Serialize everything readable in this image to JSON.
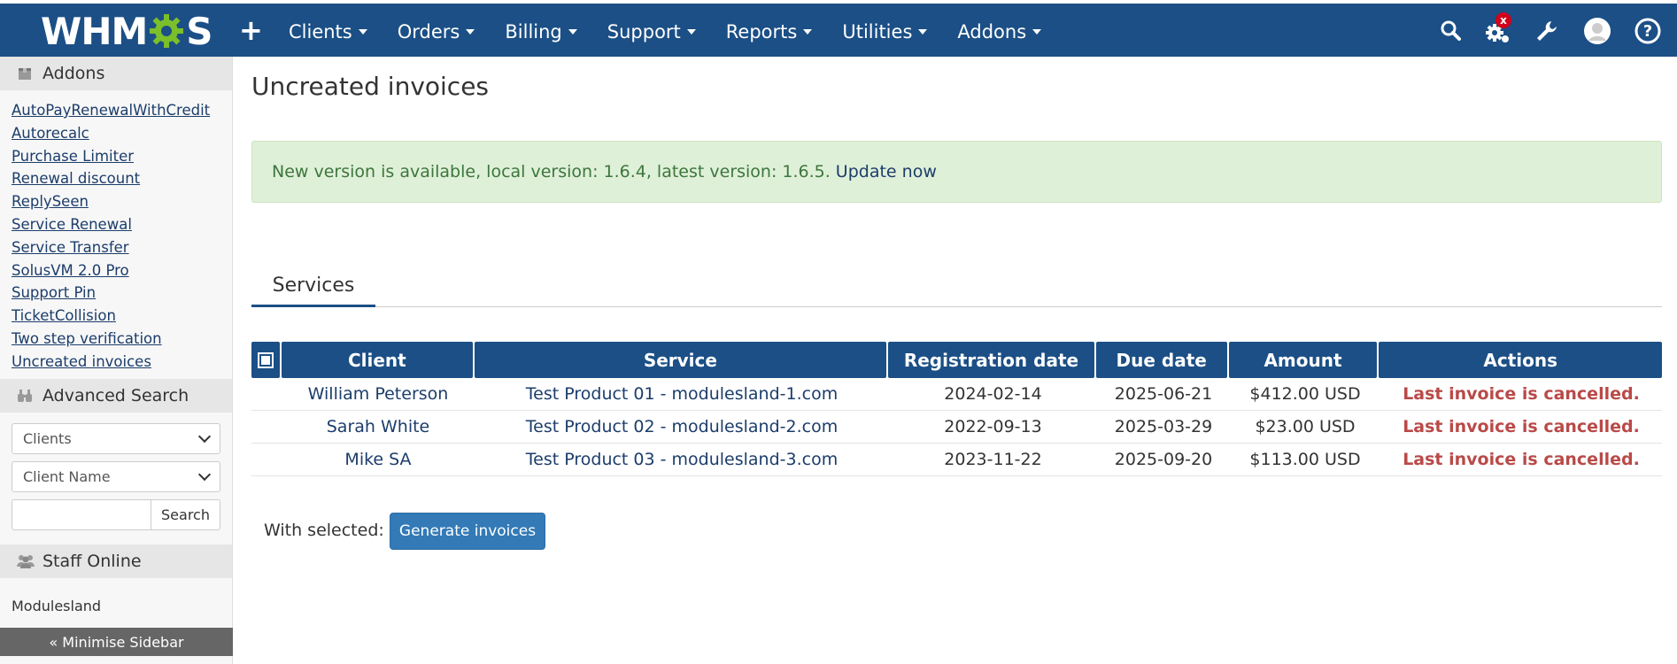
{
  "navbar": {
    "logo_text": "WHMCS",
    "plus_label": "+",
    "menu": [
      {
        "label": "Clients"
      },
      {
        "label": "Orders"
      },
      {
        "label": "Billing"
      },
      {
        "label": "Support"
      },
      {
        "label": "Reports"
      },
      {
        "label": "Utilities"
      },
      {
        "label": "Addons"
      }
    ],
    "notification_badge": "x",
    "icons": [
      "search-icon",
      "gear-icon",
      "wrench-icon",
      "avatar",
      "help-icon"
    ]
  },
  "sidebar": {
    "addons_header": "Addons",
    "addon_links": [
      "AutoPayRenewalWithCredit",
      "Autorecalc",
      "Purchase Limiter",
      "Renewal discount",
      "ReplySeen",
      "Service Renewal",
      "Service Transfer",
      "SolusVM 2.0 Pro",
      "Support Pin",
      "TicketCollision",
      "Two step verification",
      "Uncreated invoices"
    ],
    "advanced_search_header": "Advanced Search",
    "search_type": "Clients",
    "search_field": "Client Name",
    "search_input_value": "",
    "search_button": "Search",
    "staff_header": "Staff Online",
    "staff_name": "Modulesland",
    "minimise_label": "« Minimise Sidebar"
  },
  "main": {
    "title": "Uncreated invoices",
    "alert_text": "New version is available, local version: 1.6.4, latest version: 1.6.5.",
    "alert_link": "Update now",
    "tab_label": "Services",
    "table": {
      "headers": [
        "Client",
        "Service",
        "Registration date",
        "Due date",
        "Amount",
        "Actions"
      ],
      "rows": [
        {
          "client": "William Peterson",
          "service": "Test Product 01 - modulesland-1.com",
          "registration": "2024-02-14",
          "due": "2025-06-21",
          "amount": "$412.00 USD",
          "action": "Last invoice is cancelled."
        },
        {
          "client": "Sarah White",
          "service": "Test Product 02 - modulesland-2.com",
          "registration": "2022-09-13",
          "due": "2025-03-29",
          "amount": "$23.00 USD",
          "action": "Last invoice is cancelled."
        },
        {
          "client": "Mike SA",
          "service": "Test Product 03 - modulesland-3.com",
          "registration": "2023-11-22",
          "due": "2025-09-20",
          "amount": "$113.00 USD",
          "action": "Last invoice is cancelled."
        }
      ]
    },
    "with_selected_label": "With selected:",
    "generate_button": "Generate invoices"
  },
  "colors": {
    "navbar": "#1b4f86",
    "logo_gear": "#7bbf2a",
    "alert_bg": "#dff0d8",
    "alert_text": "#3c763d",
    "action_text": "#b94a48",
    "button": "#337ab7"
  }
}
